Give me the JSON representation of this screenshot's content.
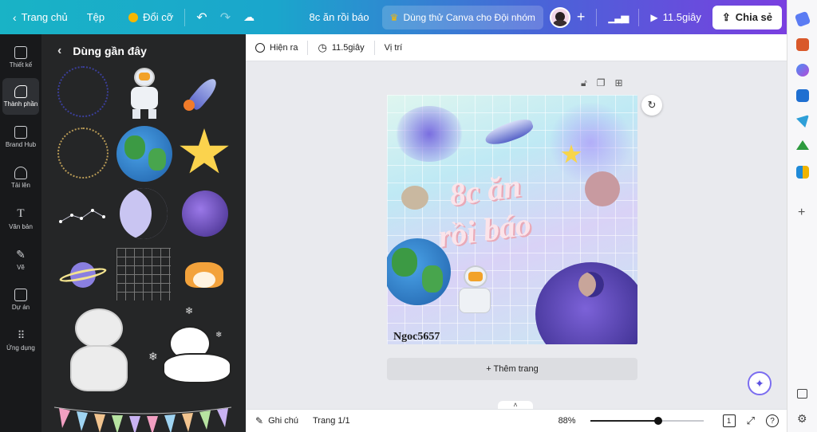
{
  "topbar": {
    "home_label": "Trang chủ",
    "file_label": "Tệp",
    "resize_label": "Đổi cỡ",
    "doc_title": "8c ăn rồi báo",
    "try_label": "Dùng thử Canva cho Đội nhóm",
    "present_label": "11.5giây",
    "share_label": "Chia sẻ"
  },
  "leftnav": {
    "items": [
      {
        "label": "Thiết kế"
      },
      {
        "label": "Thành phần"
      },
      {
        "label": "Brand Hub"
      },
      {
        "label": "Tải lên"
      },
      {
        "label": "Văn bản"
      },
      {
        "label": "Vẽ"
      },
      {
        "label": "Dự án"
      },
      {
        "label": "Ứng dụng"
      }
    ]
  },
  "panel": {
    "title": "Dùng gần đây"
  },
  "toolbar2": {
    "animate_label": "Hiện ra",
    "timing_label": "11.5giây",
    "position_label": "Vị trí"
  },
  "design": {
    "headline_1": "8c ăn",
    "headline_2": "rồi báo",
    "signature": "Ngoc5657"
  },
  "canvas": {
    "add_page_label": "+ Thêm trang"
  },
  "bottombar": {
    "notes_label": "Ghi chú",
    "page_label": "Trang 1/1",
    "zoom_label": "88%",
    "zoom_level": 0.6,
    "page_count": "1",
    "help_label": "?"
  },
  "colors": {
    "gradient_start": "#19b3c6",
    "gradient_end": "#7a3fe0",
    "panel_bg": "#252627",
    "nav_bg": "#18191b"
  }
}
